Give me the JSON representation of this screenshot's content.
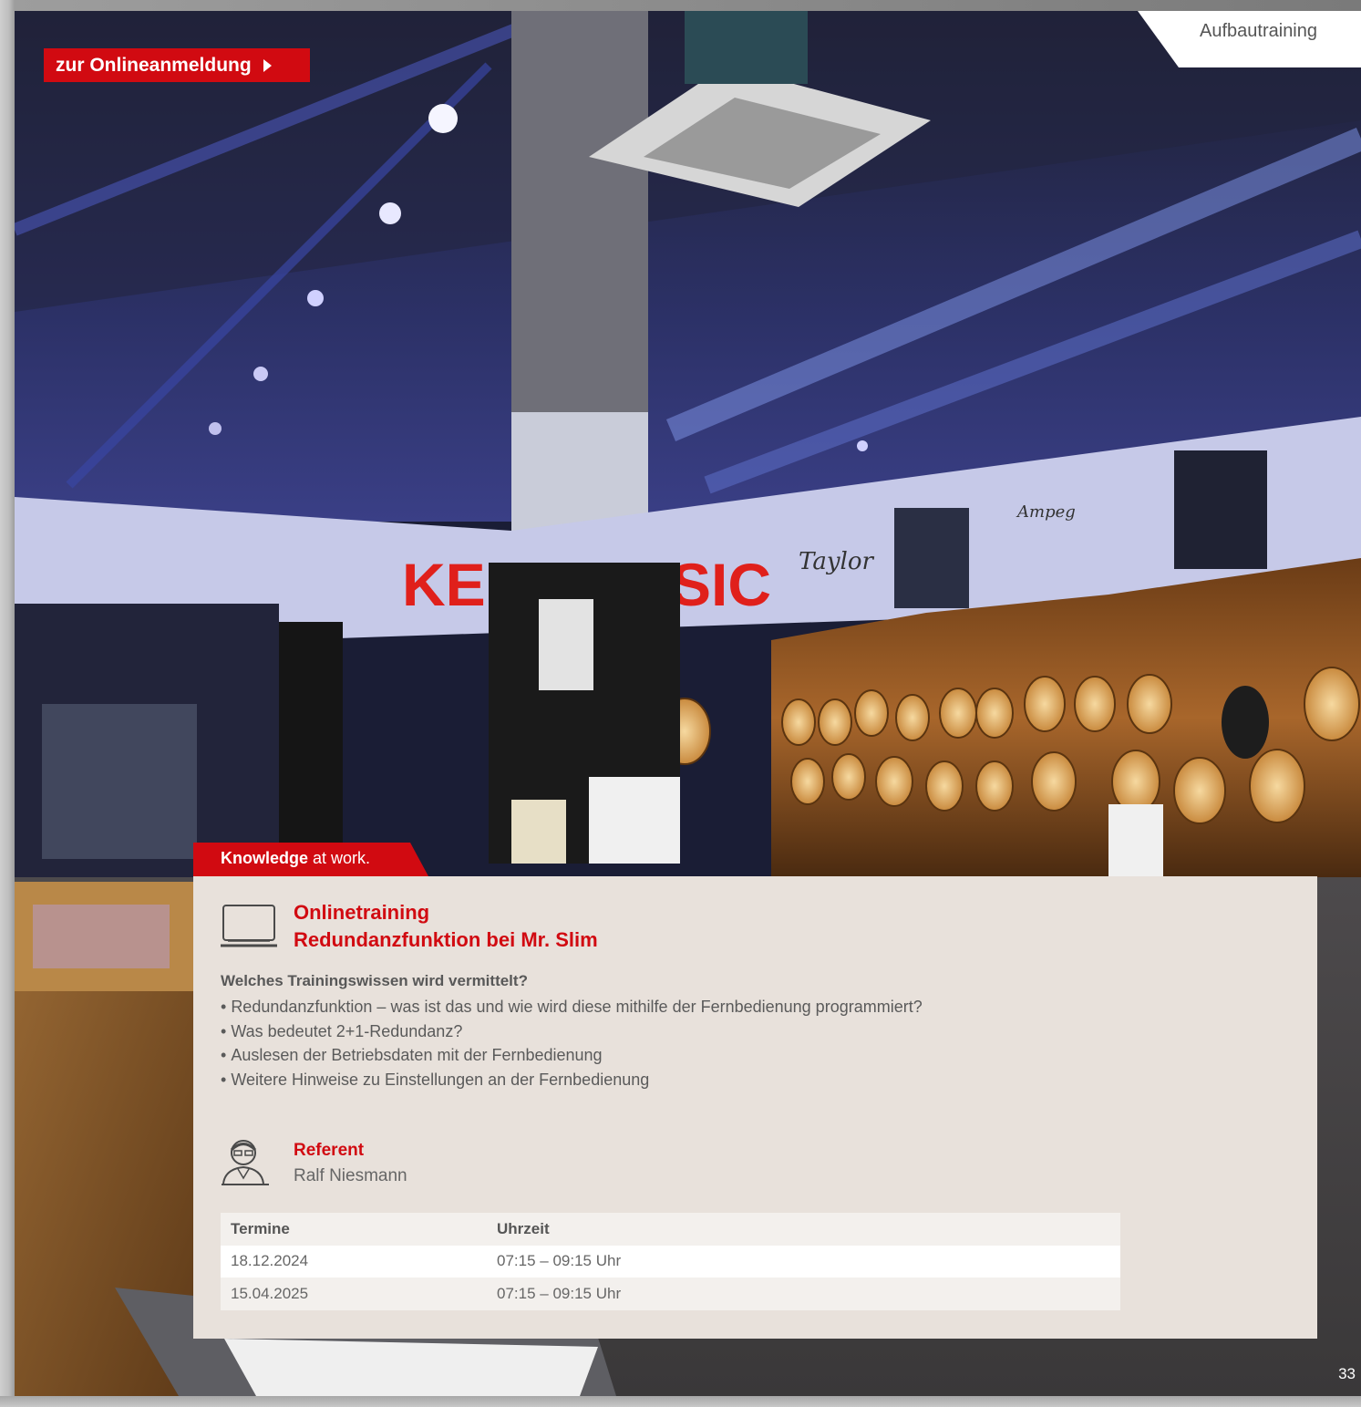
{
  "header": {
    "registration_link": "zur Onlineanmeldung",
    "section": "Aufbautraining"
  },
  "tag": {
    "bold": "Knowledge",
    "rest": " at work."
  },
  "course": {
    "icon": "laptop-icon",
    "title_line1": "Onlinetraining",
    "title_line2": "Redundanzfunktion bei Mr. Slim",
    "subheading": "Welches Trainingswissen wird vermittelt?",
    "bullets": [
      "Redundanzfunktion – was ist das und wie wird diese mithilfe der Fernbedienung programmiert?",
      "Was bedeutet 2+1-Redundanz?",
      "Auslesen der Betriebsdaten mit der Fernbedienung",
      "Weitere Hinweise zu Einstellungen an der Fernbedienung"
    ]
  },
  "referent": {
    "icon": "speaker-person-icon",
    "label": "Referent",
    "name": "Ralf Niesmann"
  },
  "schedule": {
    "headers": [
      "Termine",
      "Uhrzeit"
    ],
    "rows": [
      [
        "18.12.2024",
        "07:15 – 09:15 Uhr"
      ],
      [
        "15.04.2025",
        "07:15 – 09:15 Uhr"
      ]
    ]
  },
  "photo_signage": [
    "KE",
    "SIC",
    "Taylor",
    "Ampeg"
  ],
  "colors": {
    "brand_red": "#d10a11",
    "panel_bg": "#e8e1db"
  },
  "page_number": "33"
}
